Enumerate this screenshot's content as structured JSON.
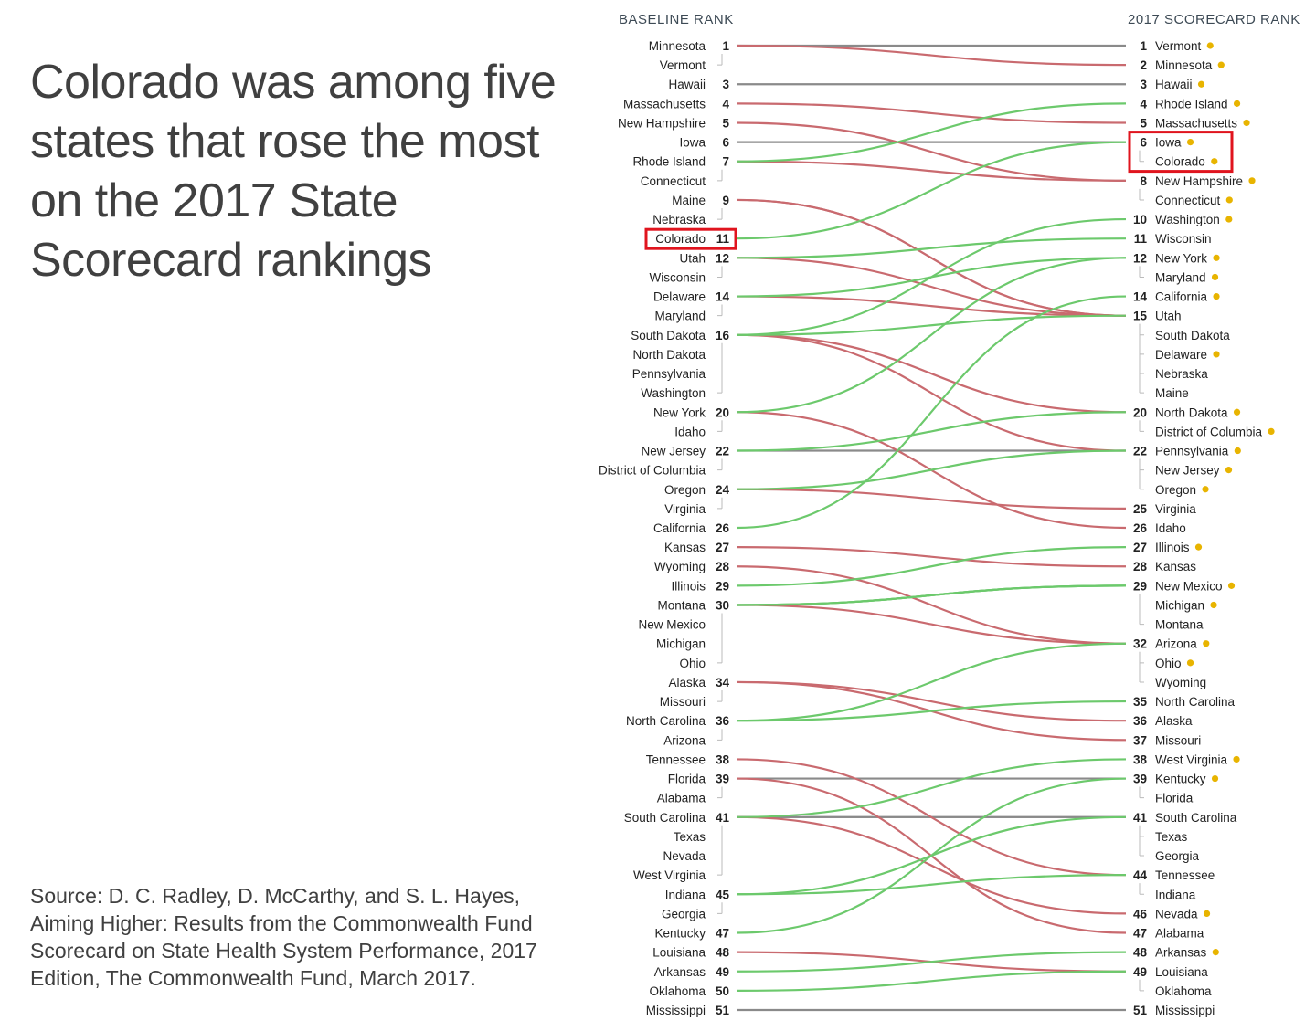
{
  "title": "Colorado was among five states that rose the most on the 2017 State Scorecard rankings",
  "source": "Source: D. C. Radley, D. McCarthy, and S. L. Hayes, Aiming Higher: Results from the Commonwealth Fund Scorecard on State Health System Performance, 2017 Edition, The Commonwealth Fund, March 2017.",
  "chart_data": {
    "type": "slope",
    "left_header": "BASELINE RANK",
    "right_header": "2017 SCORECARD RANK",
    "colors": {
      "improved": "#6cc96c",
      "declined": "#c96a6f",
      "unchanged": "#8a8a8a",
      "marker": "#e8b400",
      "highlight": "#e0141e"
    },
    "highlighted_state": "Colorado",
    "baseline": [
      {
        "state": "Minnesota",
        "rank": 1
      },
      {
        "state": "Vermont",
        "rank": 1
      },
      {
        "state": "Hawaii",
        "rank": 3
      },
      {
        "state": "Massachusetts",
        "rank": 4
      },
      {
        "state": "New Hampshire",
        "rank": 5
      },
      {
        "state": "Iowa",
        "rank": 6
      },
      {
        "state": "Rhode Island",
        "rank": 7
      },
      {
        "state": "Connecticut",
        "rank": 7
      },
      {
        "state": "Maine",
        "rank": 9
      },
      {
        "state": "Nebraska",
        "rank": 9
      },
      {
        "state": "Colorado",
        "rank": 11
      },
      {
        "state": "Utah",
        "rank": 12
      },
      {
        "state": "Wisconsin",
        "rank": 12
      },
      {
        "state": "Delaware",
        "rank": 14
      },
      {
        "state": "Maryland",
        "rank": 14
      },
      {
        "state": "South Dakota",
        "rank": 16
      },
      {
        "state": "North Dakota",
        "rank": 16
      },
      {
        "state": "Pennsylvania",
        "rank": 16
      },
      {
        "state": "Washington",
        "rank": 16
      },
      {
        "state": "New York",
        "rank": 20
      },
      {
        "state": "Idaho",
        "rank": 20
      },
      {
        "state": "New Jersey",
        "rank": 22
      },
      {
        "state": "District of Columbia",
        "rank": 22
      },
      {
        "state": "Oregon",
        "rank": 24
      },
      {
        "state": "Virginia",
        "rank": 24
      },
      {
        "state": "California",
        "rank": 26
      },
      {
        "state": "Kansas",
        "rank": 27
      },
      {
        "state": "Wyoming",
        "rank": 28
      },
      {
        "state": "Illinois",
        "rank": 29
      },
      {
        "state": "Montana",
        "rank": 30
      },
      {
        "state": "New Mexico",
        "rank": 30
      },
      {
        "state": "Michigan",
        "rank": 30
      },
      {
        "state": "Ohio",
        "rank": 30
      },
      {
        "state": "Alaska",
        "rank": 34
      },
      {
        "state": "Missouri",
        "rank": 34
      },
      {
        "state": "North Carolina",
        "rank": 36
      },
      {
        "state": "Arizona",
        "rank": 36
      },
      {
        "state": "Tennessee",
        "rank": 38
      },
      {
        "state": "Florida",
        "rank": 39
      },
      {
        "state": "Alabama",
        "rank": 39
      },
      {
        "state": "South Carolina",
        "rank": 41
      },
      {
        "state": "Texas",
        "rank": 41
      },
      {
        "state": "Nevada",
        "rank": 41
      },
      {
        "state": "West Virginia",
        "rank": 41
      },
      {
        "state": "Indiana",
        "rank": 45
      },
      {
        "state": "Georgia",
        "rank": 45
      },
      {
        "state": "Kentucky",
        "rank": 47
      },
      {
        "state": "Louisiana",
        "rank": 48
      },
      {
        "state": "Arkansas",
        "rank": 49
      },
      {
        "state": "Oklahoma",
        "rank": 50
      },
      {
        "state": "Mississippi",
        "rank": 51
      }
    ],
    "scorecard_2017": [
      {
        "state": "Vermont",
        "rank": 1,
        "marker": true
      },
      {
        "state": "Minnesota",
        "rank": 2,
        "marker": true
      },
      {
        "state": "Hawaii",
        "rank": 3,
        "marker": true
      },
      {
        "state": "Rhode Island",
        "rank": 4,
        "marker": true
      },
      {
        "state": "Massachusetts",
        "rank": 5,
        "marker": true
      },
      {
        "state": "Iowa",
        "rank": 6,
        "marker": true
      },
      {
        "state": "Colorado",
        "rank": 6,
        "marker": true
      },
      {
        "state": "New Hampshire",
        "rank": 8,
        "marker": true
      },
      {
        "state": "Connecticut",
        "rank": 8,
        "marker": true
      },
      {
        "state": "Washington",
        "rank": 10,
        "marker": true
      },
      {
        "state": "Wisconsin",
        "rank": 11,
        "marker": false
      },
      {
        "state": "New York",
        "rank": 12,
        "marker": true
      },
      {
        "state": "Maryland",
        "rank": 12,
        "marker": true
      },
      {
        "state": "California",
        "rank": 14,
        "marker": true
      },
      {
        "state": "Utah",
        "rank": 15,
        "marker": false
      },
      {
        "state": "South Dakota",
        "rank": 15,
        "marker": false
      },
      {
        "state": "Delaware",
        "rank": 15,
        "marker": true
      },
      {
        "state": "Nebraska",
        "rank": 15,
        "marker": false
      },
      {
        "state": "Maine",
        "rank": 15,
        "marker": false
      },
      {
        "state": "North Dakota",
        "rank": 20,
        "marker": true
      },
      {
        "state": "District of Columbia",
        "rank": 20,
        "marker": true
      },
      {
        "state": "Pennsylvania",
        "rank": 22,
        "marker": true
      },
      {
        "state": "New Jersey",
        "rank": 22,
        "marker": true
      },
      {
        "state": "Oregon",
        "rank": 22,
        "marker": true
      },
      {
        "state": "Virginia",
        "rank": 25,
        "marker": false
      },
      {
        "state": "Idaho",
        "rank": 26,
        "marker": false
      },
      {
        "state": "Illinois",
        "rank": 27,
        "marker": true
      },
      {
        "state": "Kansas",
        "rank": 28,
        "marker": false
      },
      {
        "state": "New Mexico",
        "rank": 29,
        "marker": true
      },
      {
        "state": "Michigan",
        "rank": 29,
        "marker": true
      },
      {
        "state": "Montana",
        "rank": 29,
        "marker": false
      },
      {
        "state": "Arizona",
        "rank": 32,
        "marker": true
      },
      {
        "state": "Ohio",
        "rank": 32,
        "marker": true
      },
      {
        "state": "Wyoming",
        "rank": 32,
        "marker": false
      },
      {
        "state": "North Carolina",
        "rank": 35,
        "marker": false
      },
      {
        "state": "Alaska",
        "rank": 36,
        "marker": false
      },
      {
        "state": "Missouri",
        "rank": 37,
        "marker": false
      },
      {
        "state": "West Virginia",
        "rank": 38,
        "marker": true
      },
      {
        "state": "Kentucky",
        "rank": 39,
        "marker": true
      },
      {
        "state": "Florida",
        "rank": 39,
        "marker": false
      },
      {
        "state": "South Carolina",
        "rank": 41,
        "marker": false
      },
      {
        "state": "Texas",
        "rank": 41,
        "marker": false
      },
      {
        "state": "Georgia",
        "rank": 41,
        "marker": false
      },
      {
        "state": "Tennessee",
        "rank": 44,
        "marker": false
      },
      {
        "state": "Indiana",
        "rank": 44,
        "marker": false
      },
      {
        "state": "Nevada",
        "rank": 46,
        "marker": true
      },
      {
        "state": "Alabama",
        "rank": 47,
        "marker": false
      },
      {
        "state": "Arkansas",
        "rank": 48,
        "marker": true
      },
      {
        "state": "Louisiana",
        "rank": 49,
        "marker": false
      },
      {
        "state": "Oklahoma",
        "rank": 49,
        "marker": false
      },
      {
        "state": "Mississippi",
        "rank": 51,
        "marker": false
      }
    ]
  }
}
